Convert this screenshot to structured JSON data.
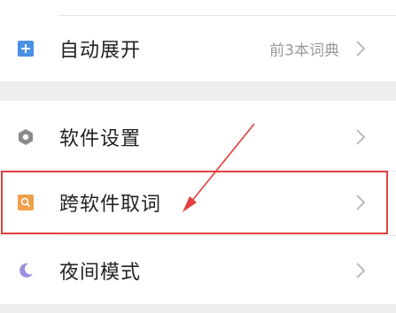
{
  "settings": {
    "rows": [
      {
        "label": "自动展开",
        "value": "前3本词典",
        "icon": "plus-square-icon",
        "icon_color": "#4a90e2"
      },
      {
        "label": "软件设置",
        "value": "",
        "icon": "hexagon-settings-icon",
        "icon_color": "#8a8a8a"
      },
      {
        "label": "跨软件取词",
        "value": "",
        "icon": "search-square-icon",
        "icon_color": "#f0a04b"
      },
      {
        "label": "夜间模式",
        "value": "",
        "icon": "moon-icon",
        "icon_color": "#9b8fe0"
      }
    ]
  },
  "annotation": {
    "color": "#e04040"
  }
}
